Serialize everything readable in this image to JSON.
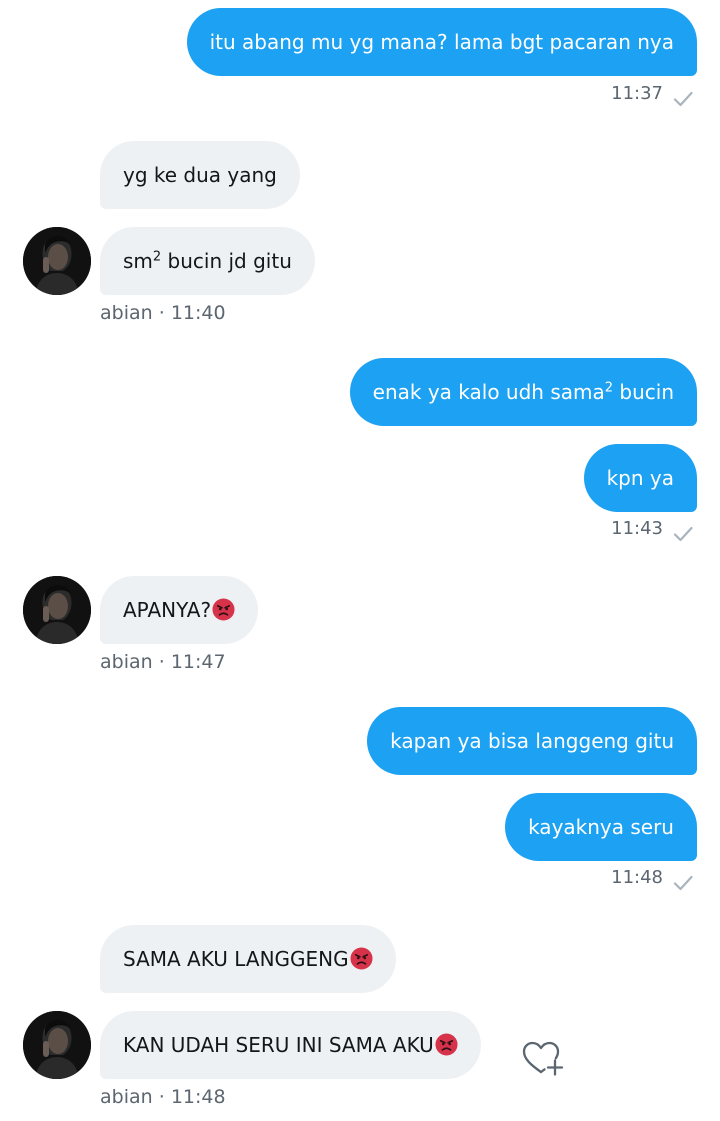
{
  "messages": {
    "m1": {
      "text": "itu abang mu yg mana? lama bgt pacaran nya"
    },
    "t1": "11:37",
    "m2": {
      "text": "yg ke dua yang"
    },
    "m3": {
      "text_a": "sm",
      "sup": "2",
      "text_b": " bucin jd gitu"
    },
    "meta3": {
      "name": "abian",
      "sep": "·",
      "time": "11:40"
    },
    "m4": {
      "text_a": "enak ya kalo udh sama",
      "sup": "2",
      "text_b": " bucin"
    },
    "m5": {
      "text": "kpn ya"
    },
    "t5": "11:43",
    "m6": {
      "text": "APANYA?",
      "emoji": "angry-face-icon"
    },
    "meta6": {
      "name": "abian",
      "sep": "·",
      "time": "11:47"
    },
    "m7": {
      "text": "kapan ya bisa langgeng gitu"
    },
    "m8": {
      "text": "kayaknya seru"
    },
    "t8": "11:48",
    "m9": {
      "text": "SAMA AKU LANGGENG",
      "emoji": "angry-face-icon"
    },
    "m10": {
      "text": "KAN UDAH SERU INI SAMA AKU",
      "emoji": "angry-face-icon"
    },
    "meta10": {
      "name": "abian",
      "sep": "·",
      "time": "11:48"
    }
  },
  "icons": {
    "read_receipt": "check-icon",
    "reaction": "heart-plus-icon",
    "avatar": "avatar"
  },
  "colors": {
    "sent_bubble": "#1da1f2",
    "received_bubble": "#eef1f3",
    "meta_text": "#5b6670",
    "check": "#a9b4bd",
    "emoji_red": "#d6334a"
  }
}
